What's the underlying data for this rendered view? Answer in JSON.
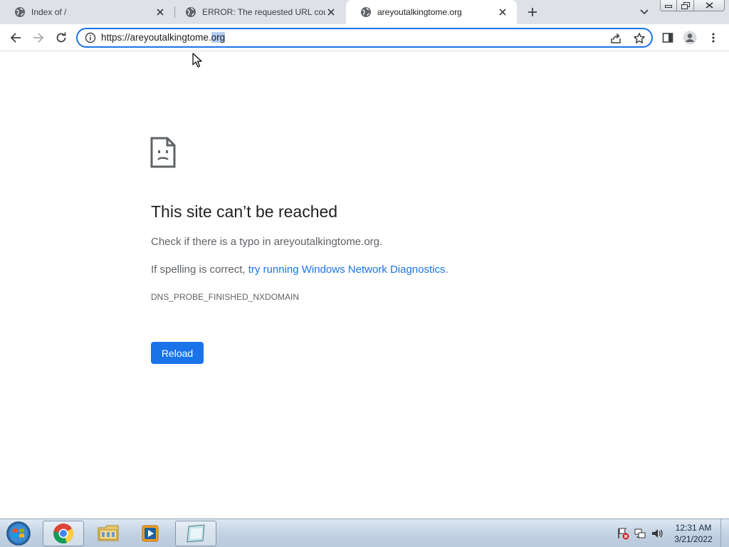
{
  "browser": {
    "tabs": [
      {
        "title": "Index of /",
        "active": false
      },
      {
        "title": "ERROR: The requested URL could",
        "active": false
      },
      {
        "title": "areyoutalkingtome.org",
        "active": true
      }
    ],
    "address": {
      "url_main": "https://areyoutalkingtome.",
      "url_selected": "org"
    }
  },
  "error_page": {
    "title": "This site can’t be reached",
    "line1": "Check if there is a typo in areyoutalkingtome.org.",
    "line2_prefix": "If spelling is correct, ",
    "line2_link": "try running Windows Network Diagnostics",
    "line2_suffix": ".",
    "error_code": "DNS_PROBE_FINISHED_NXDOMAIN",
    "reload_label": "Reload"
  },
  "taskbar": {
    "clock_time": "12:31 AM",
    "clock_date": "3/21/2022"
  },
  "colors": {
    "accent": "#1a73e8",
    "tabstrip": "#dee1e6"
  }
}
